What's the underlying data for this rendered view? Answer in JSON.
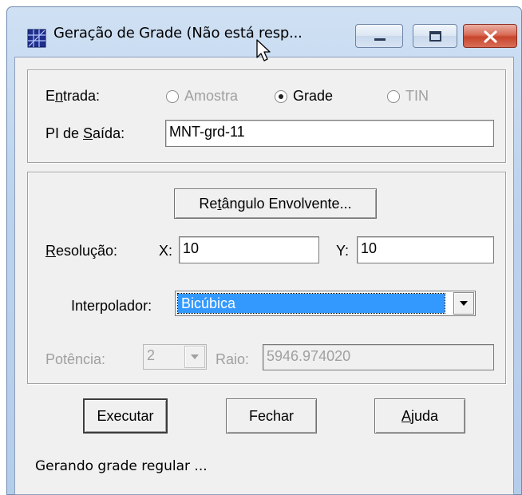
{
  "window": {
    "title": "Geração de Grade (Não está resp...",
    "controls": {
      "minimize": "minimize",
      "maximize": "maximize",
      "close": "close"
    }
  },
  "entrada": {
    "label_pre": "E",
    "label_ul": "n",
    "label_post": "trada:",
    "options": [
      {
        "label": "Amostra",
        "checked": false,
        "enabled": false
      },
      {
        "label": "Grade",
        "checked": true,
        "enabled": true
      },
      {
        "label": "TIN",
        "checked": false,
        "enabled": false
      }
    ]
  },
  "pi_saida": {
    "label_pre": "PI de ",
    "label_ul": "S",
    "label_post": "aída:",
    "value": "MNT-grd-11"
  },
  "retangulo_button": {
    "pre": "Re",
    "ul": "t",
    "post": "ângulo Envolvente..."
  },
  "resolucao": {
    "label_ul": "R",
    "label_post": "esolução:",
    "x_label": "X:",
    "x_value": "10",
    "y_label": "Y:",
    "y_value": "10"
  },
  "interpolador": {
    "label": "Interpolador:",
    "value": "Bicúbica"
  },
  "potencia": {
    "label": "Potência:",
    "value": "2"
  },
  "raio": {
    "label": "Raio:",
    "value": "5946.974020"
  },
  "buttons": {
    "executar": "Executar",
    "fechar": "Fechar",
    "ajuda_ul": "A",
    "ajuda_post": "juda"
  },
  "status": "Gerando grade regular ..."
}
